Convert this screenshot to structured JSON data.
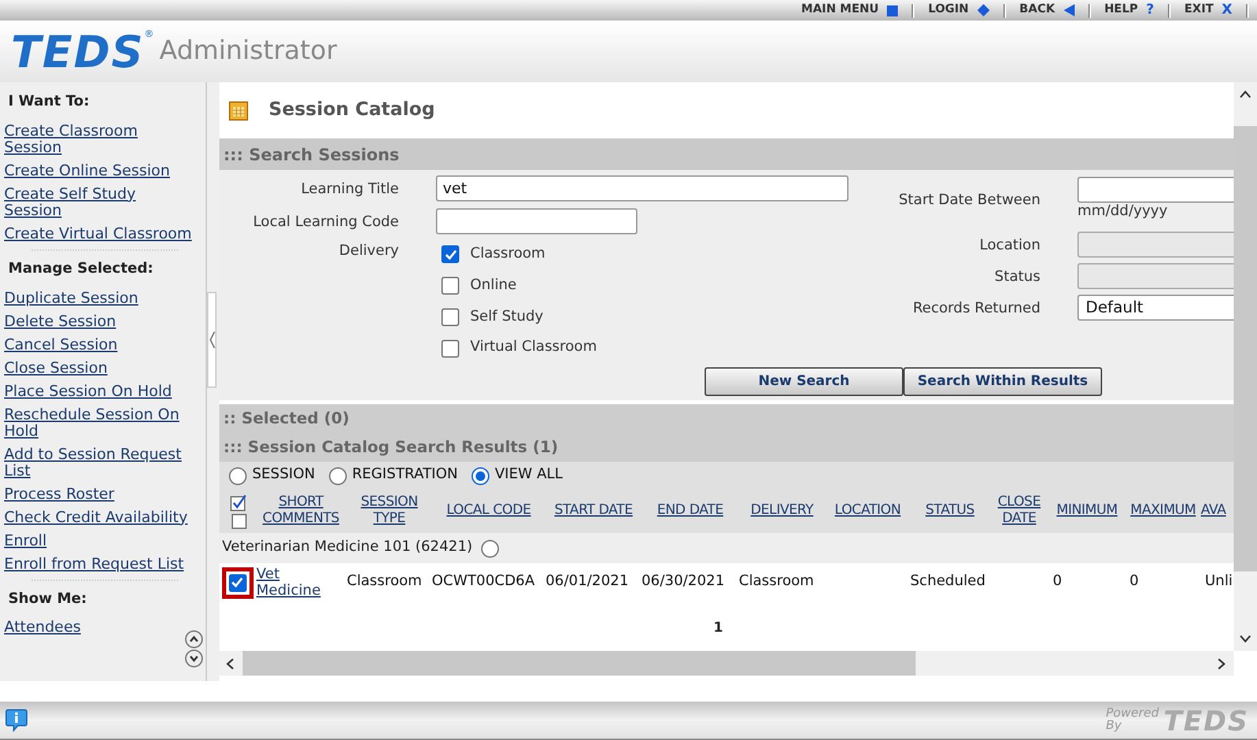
{
  "top_nav": [
    {
      "label": "MAIN MENU",
      "kind": "square"
    },
    {
      "label": "LOGIN",
      "kind": "diamond"
    },
    {
      "label": "BACK",
      "kind": "left"
    },
    {
      "label": "HELP",
      "glyph": "?"
    },
    {
      "label": "EXIT",
      "glyph": "X"
    }
  ],
  "logo": {
    "text": "TEDS",
    "mark": "®",
    "subtitle": "Administrator"
  },
  "sidebar": {
    "sections": [
      {
        "title": "I Want To:",
        "links": [
          "Create Classroom Session",
          "Create Online Session",
          "Create Self Study Session",
          "Create Virtual Classroom"
        ]
      },
      {
        "title": "Manage Selected:",
        "links": [
          "Duplicate Session",
          "Delete Session",
          "Cancel Session",
          "Close Session",
          "Place Session On Hold",
          "Reschedule Session On Hold",
          "Add to Session Request List",
          "Process Roster",
          "Check Credit Availability",
          "Enroll",
          "Enroll from Request List"
        ]
      },
      {
        "title": "Show Me:",
        "links": [
          "Attendees"
        ]
      }
    ]
  },
  "page_title": "Session Catalog",
  "search": {
    "header": "::: Search Sessions",
    "learning_title": {
      "label": "Learning Title",
      "value": "vet"
    },
    "local_code": {
      "label": "Local Learning Code"
    },
    "delivery": {
      "label": "Delivery",
      "options": [
        {
          "label": "Classroom",
          "checked": true
        },
        {
          "label": "Online",
          "checked": false
        },
        {
          "label": "Self Study",
          "checked": false
        },
        {
          "label": "Virtual Classroom",
          "checked": false
        }
      ]
    },
    "start_date": {
      "label": "Start Date Between",
      "hint": "mm/dd/yyyy"
    },
    "location": {
      "label": "Location"
    },
    "status": {
      "label": "Status"
    },
    "records": {
      "label": "Records Returned",
      "value": "Default"
    },
    "buttons": [
      "New Search",
      "Search Within Results"
    ]
  },
  "selected_header": ":: Selected (0)",
  "results": {
    "header": "::: Session Catalog Search Results (1)",
    "views": [
      {
        "label": "SESSION",
        "selected": false
      },
      {
        "label": "REGISTRATION",
        "selected": false
      },
      {
        "label": "VIEW ALL",
        "selected": true
      }
    ],
    "columns": [
      "SHORT COMMENTS",
      "SESSION TYPE",
      "LOCAL CODE",
      "START DATE",
      "END DATE",
      "DELIVERY",
      "LOCATION",
      "STATUS",
      "CLOSE DATE",
      "MINIMUM",
      "MAXIMUM",
      "AVA"
    ],
    "group": {
      "title": "Veterinarian Medicine 101 (62421)",
      "selected": false
    },
    "rows": [
      {
        "checked": true,
        "highlighted": true,
        "cells": [
          "Vet Medicine",
          "Classroom",
          "OCWT00CD6A",
          "06/01/2021",
          "06/30/2021",
          "Classroom",
          "",
          "Scheduled",
          "",
          "0",
          "0",
          "Unli"
        ]
      }
    ],
    "page": "1"
  },
  "footer": {
    "powered": "Powered By",
    "brand": "TEDS"
  }
}
